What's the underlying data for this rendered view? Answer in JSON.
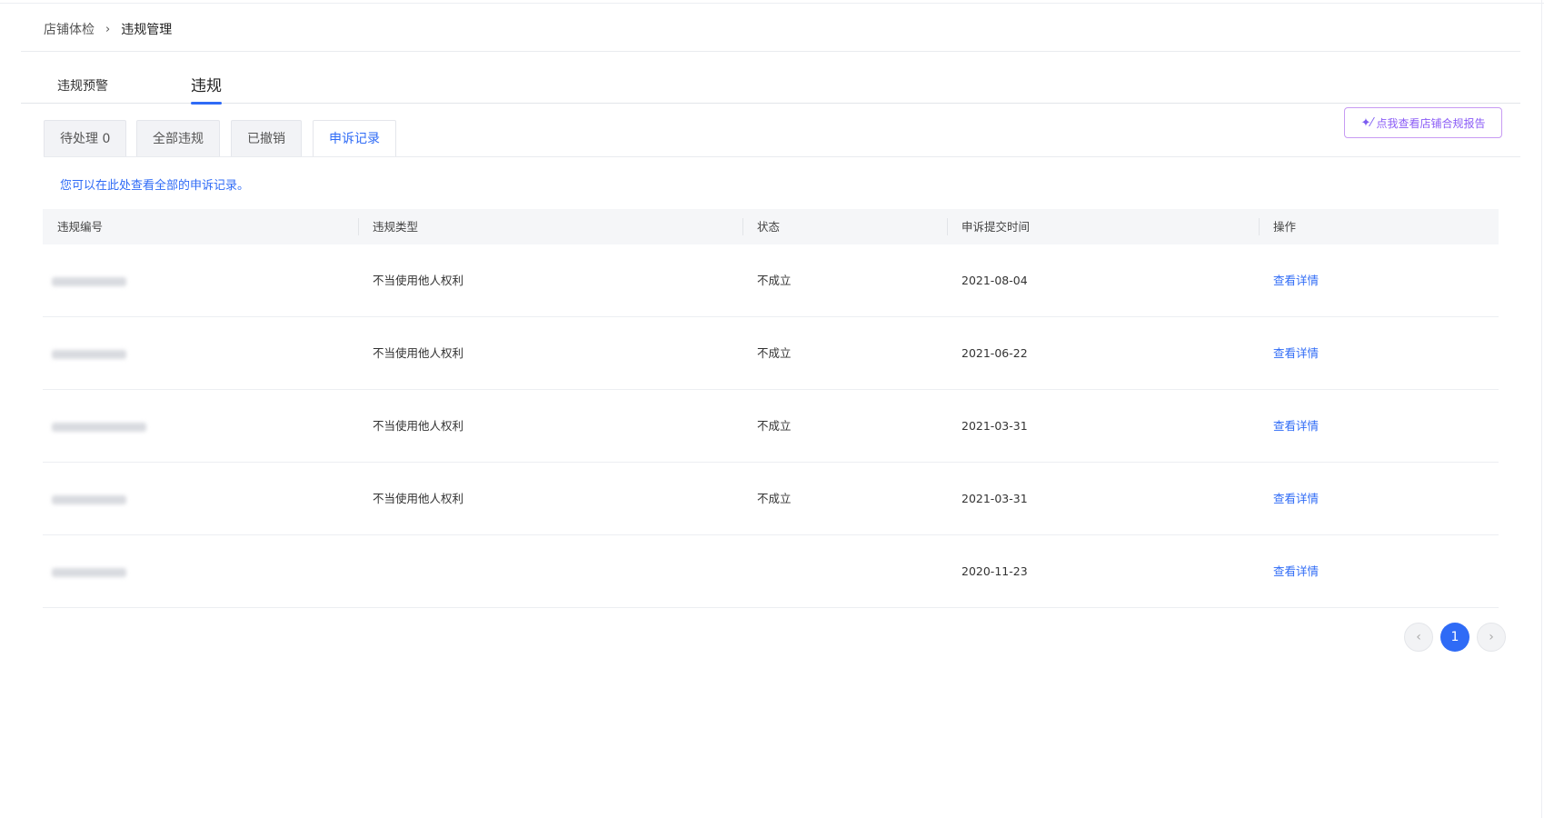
{
  "breadcrumb": {
    "item1": "店铺体检",
    "separator": "›",
    "item2": "违规管理"
  },
  "main_tabs": {
    "tab1": "违规预警",
    "tab2": "违规"
  },
  "sub_tabs": {
    "pending": "待处理 0",
    "all": "全部违规",
    "revoked": "已撤销",
    "appeals": "申诉记录"
  },
  "report_button": {
    "icon": "sparkle-icon",
    "label": "点我查看店铺合规报告"
  },
  "notice": "您可以在此处查看全部的申诉记录。",
  "table": {
    "headers": [
      "违规编号",
      "违规类型",
      "状态",
      "申诉提交时间",
      "操作"
    ],
    "rows": [
      {
        "type": "不当使用他人权利",
        "status": "不成立",
        "date": "2021-08-04",
        "action": "查看详情"
      },
      {
        "type": "不当使用他人权利",
        "status": "不成立",
        "date": "2021-06-22",
        "action": "查看详情"
      },
      {
        "type": "不当使用他人权利",
        "status": "不成立",
        "date": "2021-03-31",
        "action": "查看详情"
      },
      {
        "type": "不当使用他人权利",
        "status": "不成立",
        "date": "2021-03-31",
        "action": "查看详情"
      },
      {
        "type": "",
        "status": "",
        "date": "2020-11-23",
        "action": "查看详情"
      }
    ]
  },
  "pagination": {
    "prev": "‹",
    "current": "1",
    "next": "›"
  },
  "colors": {
    "accent": "#2f6bf6",
    "report_border": "#c79bf3"
  }
}
